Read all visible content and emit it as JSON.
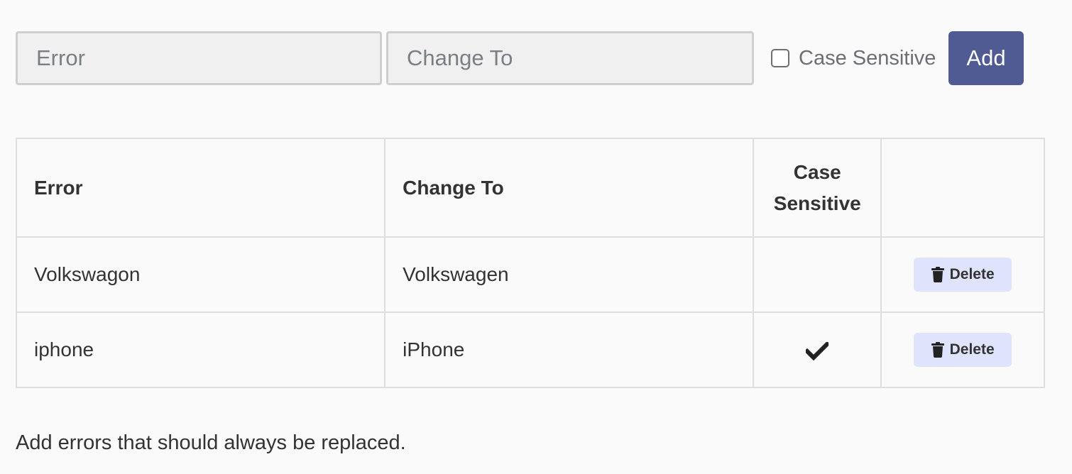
{
  "form": {
    "error_placeholder": "Error",
    "change_placeholder": "Change To",
    "case_sensitive_label": "Case Sensitive",
    "case_sensitive_checked": false,
    "add_label": "Add"
  },
  "table": {
    "headers": {
      "error": "Error",
      "change_to": "Change To",
      "case_sensitive": "Case Sensitive"
    },
    "rows": [
      {
        "error": "Volkswagon",
        "change_to": "Volkswagen",
        "case_sensitive": false,
        "delete_label": "Delete"
      },
      {
        "error": "iphone",
        "change_to": "iPhone",
        "case_sensitive": true,
        "delete_label": "Delete"
      }
    ]
  },
  "footer": {
    "note": "Add errors that should always be replaced."
  },
  "icons": {
    "trash": "trash-icon",
    "check": "check-icon"
  },
  "colors": {
    "add_button_bg": "#505b93",
    "delete_button_bg": "#dfe3fb",
    "input_bg": "#f0f0f0",
    "page_bg": "#fafafa"
  }
}
